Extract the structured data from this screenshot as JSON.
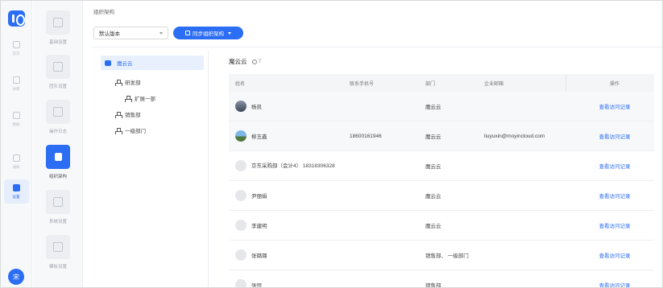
{
  "rail": {
    "items": [
      {
        "label": "首页",
        "icon": "home-icon"
      },
      {
        "label": "访客",
        "icon": "visitor-icon"
      },
      {
        "label": "数据",
        "icon": "data-icon"
      },
      {
        "label": "通知",
        "icon": "notice-icon"
      },
      {
        "label": "设置",
        "icon": "settings-icon"
      }
    ],
    "avatar_initial": "宋"
  },
  "subnav": {
    "items": [
      {
        "label": "基础设置",
        "icon": "gear-icon"
      },
      {
        "label": "团队设置",
        "icon": "team-icon"
      },
      {
        "label": "操作日志",
        "icon": "log-icon"
      },
      {
        "label": "组织架构",
        "icon": "org-icon"
      },
      {
        "label": "系统设置",
        "icon": "sliders-icon"
      },
      {
        "label": "模板设置",
        "icon": "template-icon"
      }
    ]
  },
  "header": {
    "title": "组织架构",
    "version_select": "默认版本",
    "sync_button": "同步组织架构"
  },
  "tree": {
    "root": "魔云云",
    "nodes": [
      "研发部",
      "扩展一部",
      "销售部",
      "一级部门"
    ]
  },
  "detail": {
    "org_name": "魔云云",
    "member_count": "7"
  },
  "table": {
    "headers": {
      "name": "姓名",
      "phone": "联系手机号",
      "dept": "部门",
      "email": "企业邮箱",
      "op": "操作"
    },
    "rows": [
      {
        "name": "杨凯",
        "phone": "",
        "dept": "魔云云",
        "email": "",
        "op": "查看访问记录"
      },
      {
        "name": "柳玉鑫",
        "phone": "18600161946",
        "dept": "魔云云",
        "email": "liuyuxin@moyincloud.com",
        "op": "查看访问记录"
      },
      {
        "name": "京东采购部（会计4） 18318306328",
        "phone": "",
        "dept": "魔云云",
        "email": "",
        "op": "查看访问记录"
      },
      {
        "name": "尹丽娟",
        "phone": "",
        "dept": "魔云云",
        "email": "",
        "op": "查看访问记录"
      },
      {
        "name": "李建明",
        "phone": "",
        "dept": "魔云云",
        "email": "",
        "op": "查看访问记录"
      },
      {
        "name": "张璐璐",
        "phone": "",
        "dept": "销售部、 一级部门",
        "email": "",
        "op": "查看访问记录"
      },
      {
        "name": "张恒",
        "phone": "",
        "dept": "销售部",
        "email": "",
        "op": "查看访问记录"
      }
    ]
  },
  "colors": {
    "accent": "#2b6df3",
    "rail_bg": "#f7f8fa",
    "selected_bg": "#e8f0fe"
  }
}
